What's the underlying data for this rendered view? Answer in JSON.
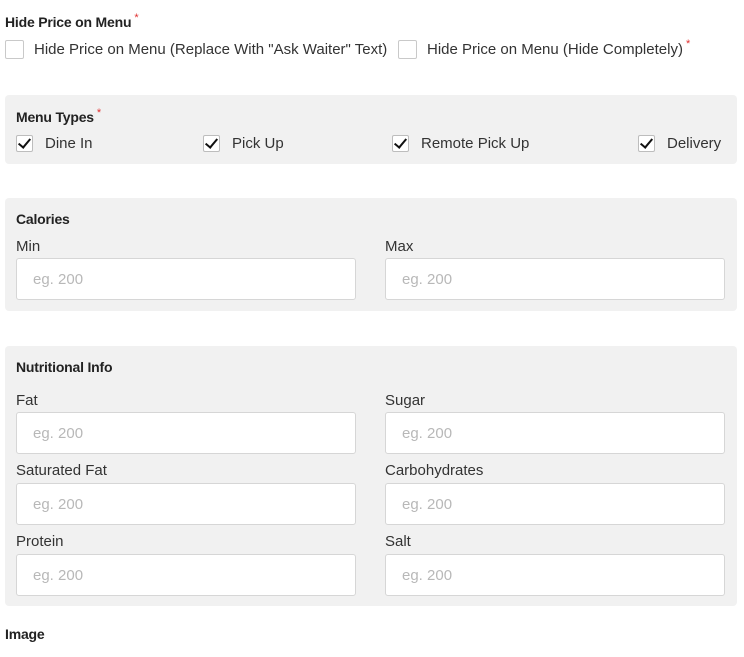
{
  "hide_price": {
    "title": "Hide Price on Menu",
    "required_mark": "*",
    "options": [
      {
        "label": "Hide Price on Menu (Replace With \"Ask Waiter\" Text)",
        "checked": false
      },
      {
        "label": "Hide Price on Menu (Hide Completely)",
        "checked": false
      }
    ],
    "option2_required_mark": "*"
  },
  "menu_types": {
    "title": "Menu Types",
    "required_mark": "*",
    "options": [
      {
        "label": "Dine In",
        "checked": true
      },
      {
        "label": "Pick Up",
        "checked": true
      },
      {
        "label": "Remote Pick Up",
        "checked": true
      },
      {
        "label": "Delivery",
        "checked": true
      }
    ]
  },
  "calories": {
    "title": "Calories",
    "min_label": "Min",
    "max_label": "Max",
    "min_placeholder": "eg. 200",
    "max_placeholder": "eg. 200"
  },
  "nutrition": {
    "title": "Nutritional Info",
    "fields": {
      "fat": {
        "label": "Fat",
        "placeholder": "eg. 200"
      },
      "sugar": {
        "label": "Sugar",
        "placeholder": "eg. 200"
      },
      "saturated_fat": {
        "label": "Saturated Fat",
        "placeholder": "eg. 200"
      },
      "carbohydrates": {
        "label": "Carbohydrates",
        "placeholder": "eg. 200"
      },
      "protein": {
        "label": "Protein",
        "placeholder": "eg. 200"
      },
      "salt": {
        "label": "Salt",
        "placeholder": "eg. 200"
      }
    }
  },
  "image": {
    "title": "Image"
  },
  "colors": {
    "panel_bg": "#f1f1f1",
    "required": "#e03030",
    "placeholder": "#b8b8b8"
  }
}
